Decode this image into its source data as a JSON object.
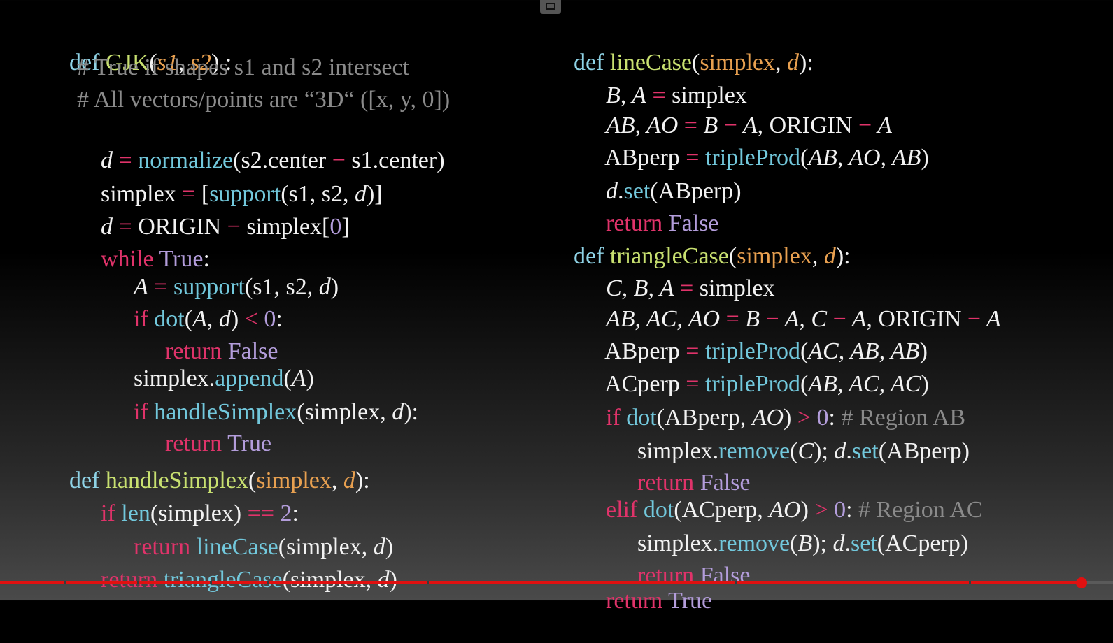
{
  "player": {
    "progress": 0.972,
    "accent": "#e01010",
    "pip_icon": "picture-in-picture-icon"
  },
  "left": {
    "l1": {
      "def": "def ",
      "name": "GJK",
      "open": "(",
      "p1": "s1",
      ",": ", ",
      "p2": "s2",
      "close": ")",
      ":": " :"
    },
    "l2": "# True if shapes s1 and s2 intersect",
    "l3": "# All vectors/points are “3D“ ([x, y, 0])",
    "l4": {
      "d": "d",
      "eq": " = ",
      "fn": "normalize",
      "rest": "(s2.center ",
      "minus": "−",
      "rest2": " s1.center)"
    },
    "l5": {
      "a": "simplex ",
      "eq": "=",
      "b": " [",
      "fn": "support",
      "c": "(s1, s2, ",
      "d": "d",
      "e": ")]"
    },
    "l6": {
      "d": "d",
      "eq": " = ",
      "b": "ORIGIN ",
      "minus": "−",
      "c": " simplex[",
      "n": "0",
      "e": "]"
    },
    "l7": {
      "kw": "while ",
      "c": "True",
      ":": ":"
    },
    "l8": {
      "a": "A",
      "eq": " = ",
      "fn": "support",
      "b": "(s1, s2, ",
      "d": "d",
      "e": ")"
    },
    "l9": {
      "kw": "if ",
      "fn": "dot",
      "b": "(",
      "a": "A",
      "c": ", ",
      "d": "d",
      "e": ") ",
      "lt": "<",
      "f": " ",
      "n": "0",
      ":": ":"
    },
    "l10": {
      "kw": "return ",
      "c": "False"
    },
    "l11": {
      "a": "simplex.",
      "fn": "append",
      "b": "(",
      "v": "A",
      "e": ")"
    },
    "l12": {
      "kw": "if ",
      "fn": "handleSimplex",
      "b": "(simplex, ",
      "d": "d",
      "e": "):"
    },
    "l13": {
      "kw": "return ",
      "c": "True"
    },
    "l14": {
      "def": "def ",
      "name": "handleSimplex",
      "open": "(",
      "p1": "simplex",
      ",": ", ",
      "p2": "d",
      "close": "):"
    },
    "l15": {
      "kw": "if ",
      "fn": "len",
      "b": "(simplex) ",
      "eq": "==",
      "f": " ",
      "n": "2",
      ":": ":"
    },
    "l16": {
      "kw": "return ",
      "fn": "lineCase",
      "b": "(simplex, ",
      "d": "d",
      "e": ")"
    },
    "l17": {
      "kw": "return ",
      "fn": "triangleCase",
      "b": "(simplex, ",
      "d": "d",
      "e": ")"
    }
  },
  "right": {
    "r1": {
      "def": "def ",
      "name": "lineCase",
      "open": "(",
      "p1": "simplex",
      ",": ", ",
      "p2": "d",
      "close": "):"
    },
    "r2": {
      "a": "B, A",
      "eq": " = ",
      "b": "simplex"
    },
    "r3": {
      "a": "AB, AO",
      "eq": " = ",
      "b": "B ",
      "m1": "−",
      "c": " A, ",
      "d": "ORIGIN ",
      "m2": "−",
      "e": " A"
    },
    "r4": {
      "a": "ABperp ",
      "eq": "=",
      "f": " ",
      "fn": "tripleProd",
      "b": "(",
      "c": "AB, AO, AB",
      "e": ")"
    },
    "r5": {
      "d": "d",
      "dot": ".",
      "fn": "set",
      "b": "(ABperp)"
    },
    "r6": {
      "kw": "return ",
      "c": "False"
    },
    "r7": {
      "def": "def ",
      "name": "triangleCase",
      "open": "(",
      "p1": "simplex",
      ",": ", ",
      "p2": "d",
      "close": "):"
    },
    "r8": {
      "a": "C, B, A",
      "eq": " = ",
      "b": "simplex"
    },
    "r9": {
      "a": "AB, AC, AO",
      "eq": " = ",
      "b": "B ",
      "m1": "−",
      "c": " A, C ",
      "m2": "−",
      "d": " A, ",
      "e": "ORIGIN ",
      "m3": "−",
      "f": " A"
    },
    "r10": {
      "a": "ABperp ",
      "eq": "=",
      "f": " ",
      "fn": "tripleProd",
      "b": "(",
      "c": "AC, AB, AB",
      "e": ")"
    },
    "r11": {
      "a": "ACperp ",
      "eq": "=",
      "f": " ",
      "fn": "tripleProd",
      "b": "(",
      "c": "AB, AC, AC",
      "e": ")"
    },
    "r12": {
      "kw": "if ",
      "fn": "dot",
      "b": "(ABperp, ",
      "v": "AO",
      "e": ") ",
      "gt": ">",
      "f": " ",
      "n": "0",
      ":": ": ",
      "cm": "# Region AB"
    },
    "r13": {
      "a": "simplex.",
      "fn": "remove",
      "b": "(",
      "v": "C",
      "e": "); ",
      "d": "d",
      "dot": ".",
      "fn2": "set",
      "g": "(ABperp)"
    },
    "r14": {
      "kw": "return ",
      "c": "False"
    },
    "r15": {
      "kw": "elif ",
      "fn": "dot",
      "b": "(ACperp, ",
      "v": "AO",
      "e": ") ",
      "gt": ">",
      "f": " ",
      "n": "0",
      ":": ": ",
      "cm": "# Region AC"
    },
    "r16": {
      "a": "simplex.",
      "fn": "remove",
      "b": "(",
      "v": "B",
      "e": "); ",
      "d": "d",
      "dot": ".",
      "fn2": "set",
      "g": "(ACperp)"
    },
    "r17": {
      "kw": "return ",
      "c": "False"
    },
    "r18": {
      "kw": "return ",
      "c": "True"
    }
  }
}
